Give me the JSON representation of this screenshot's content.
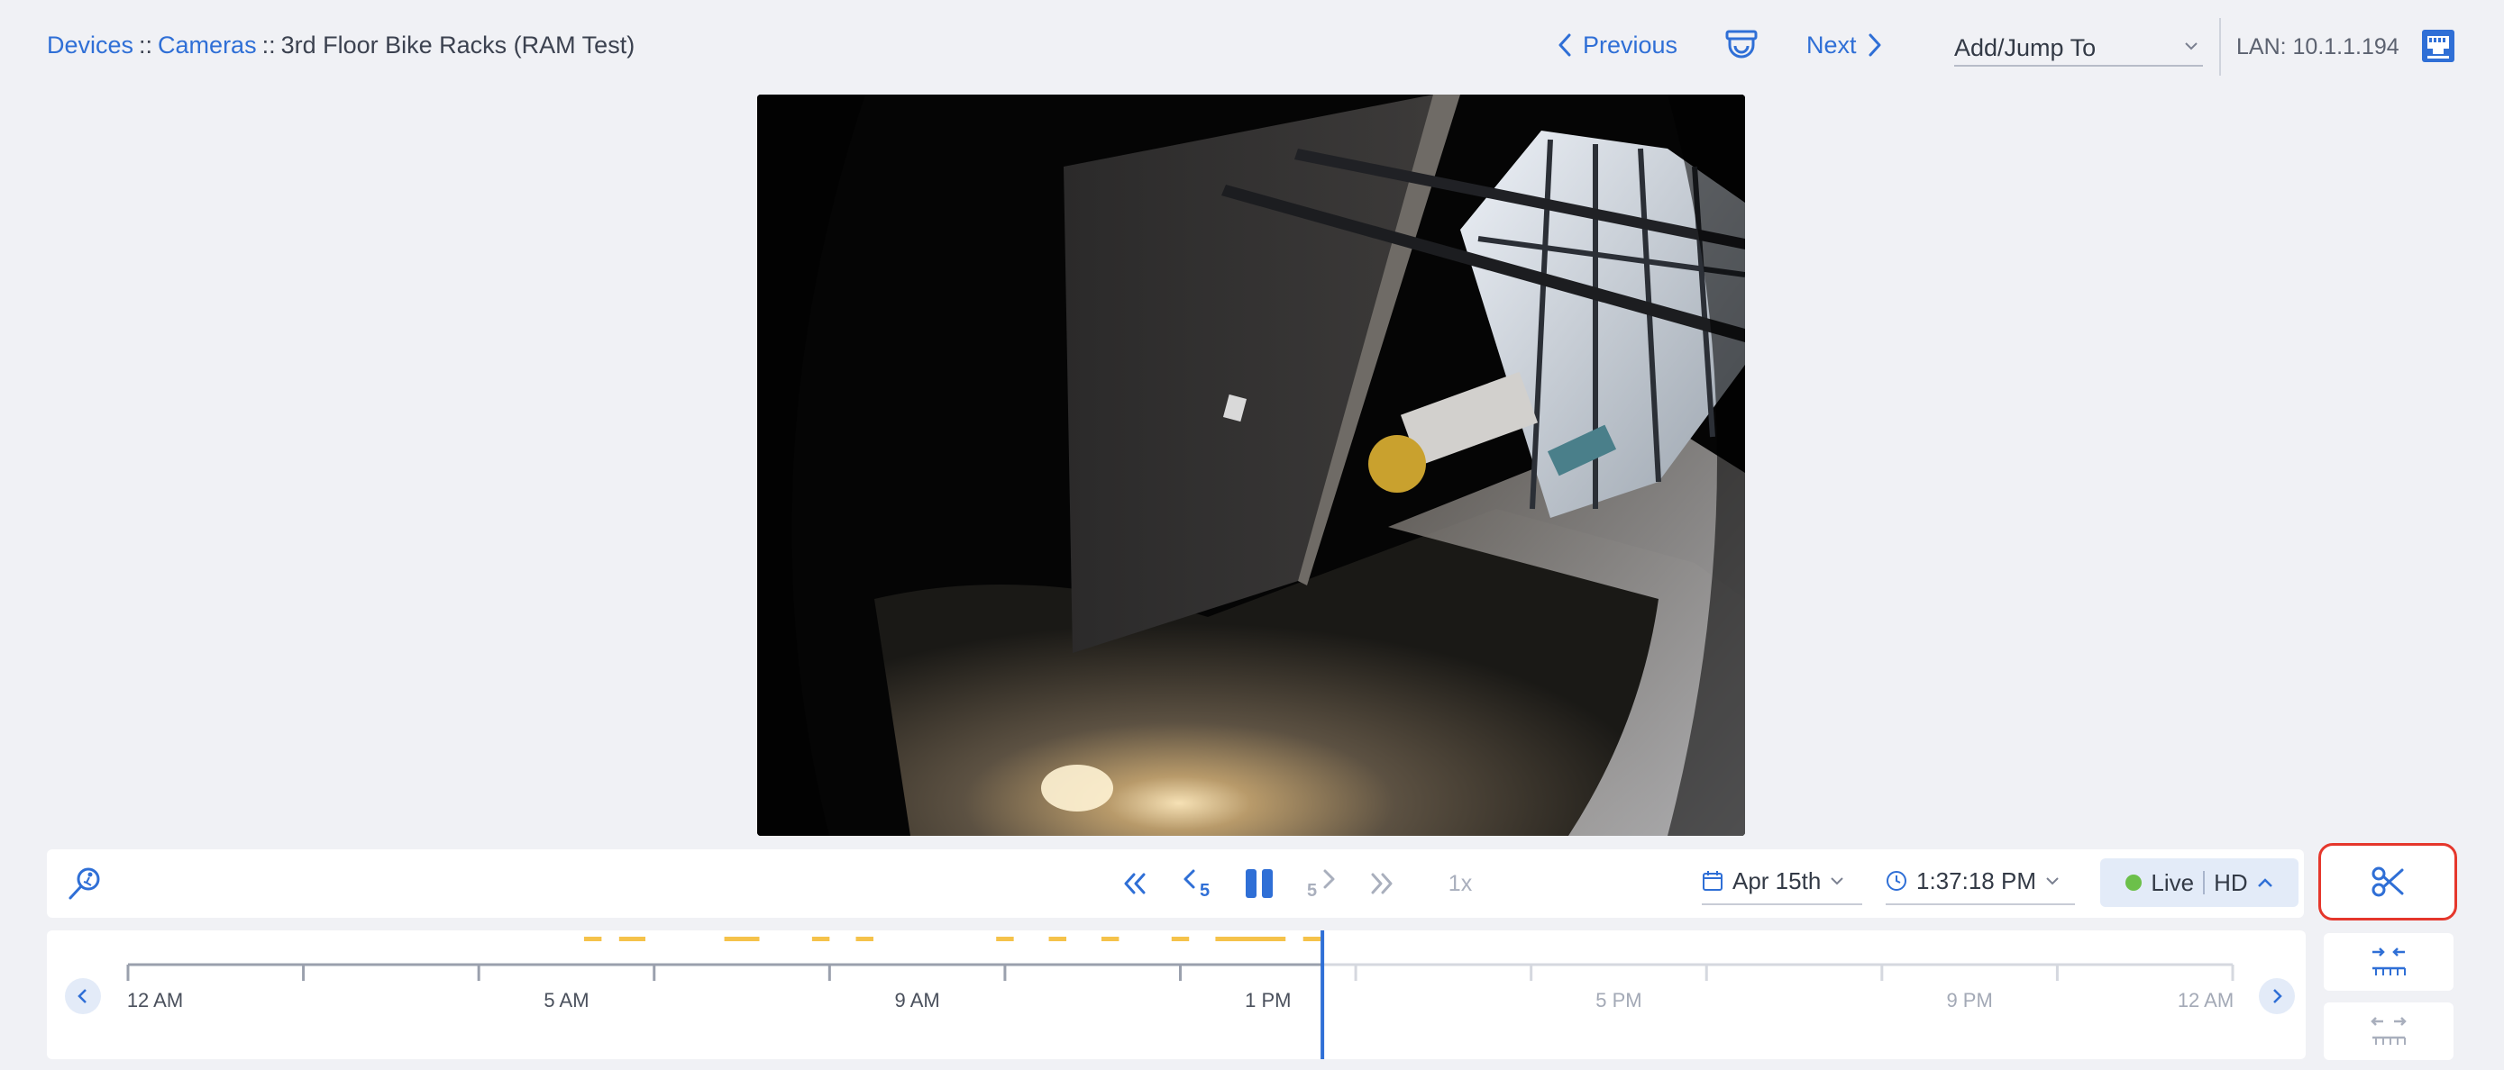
{
  "breadcrumb": {
    "items": [
      "Devices",
      "Cameras"
    ],
    "separator": "::",
    "current": "3rd Floor Bike Racks (RAM Test)"
  },
  "nav": {
    "previous_label": "Previous",
    "next_label": "Next",
    "jump_select": {
      "selected": "Add/Jump To"
    },
    "lan_label": "LAN: 10.1.1.194"
  },
  "video": {
    "description_icon": "camera-feed"
  },
  "controls": {
    "skip_back_seconds": "5",
    "skip_forward_seconds": "5",
    "speed": "1x",
    "date": "Apr 15th",
    "time": "1:37:18 PM",
    "live_label": "Live",
    "quality_label": "HD"
  },
  "timeline": {
    "tick_labels": [
      "12 AM",
      "5 AM",
      "9 AM",
      "1 PM",
      "5 PM",
      "9 PM",
      "12 AM"
    ],
    "current_time_hours": 13.62,
    "span_hours": 24,
    "motion_events_hours": [
      [
        5.2,
        5.4
      ],
      [
        5.6,
        5.9
      ],
      [
        6.8,
        7.2
      ],
      [
        7.8,
        8.0
      ],
      [
        8.3,
        8.5
      ],
      [
        9.9,
        10.1
      ],
      [
        10.5,
        10.7
      ],
      [
        11.1,
        11.3
      ],
      [
        11.9,
        12.1
      ],
      [
        12.4,
        13.2
      ],
      [
        13.4,
        13.6
      ]
    ]
  },
  "colors": {
    "accent": "#2f6fd6",
    "live_dot": "#6cc04a",
    "motion_event": "#f5c24a",
    "clip_highlight": "#e5372c"
  }
}
